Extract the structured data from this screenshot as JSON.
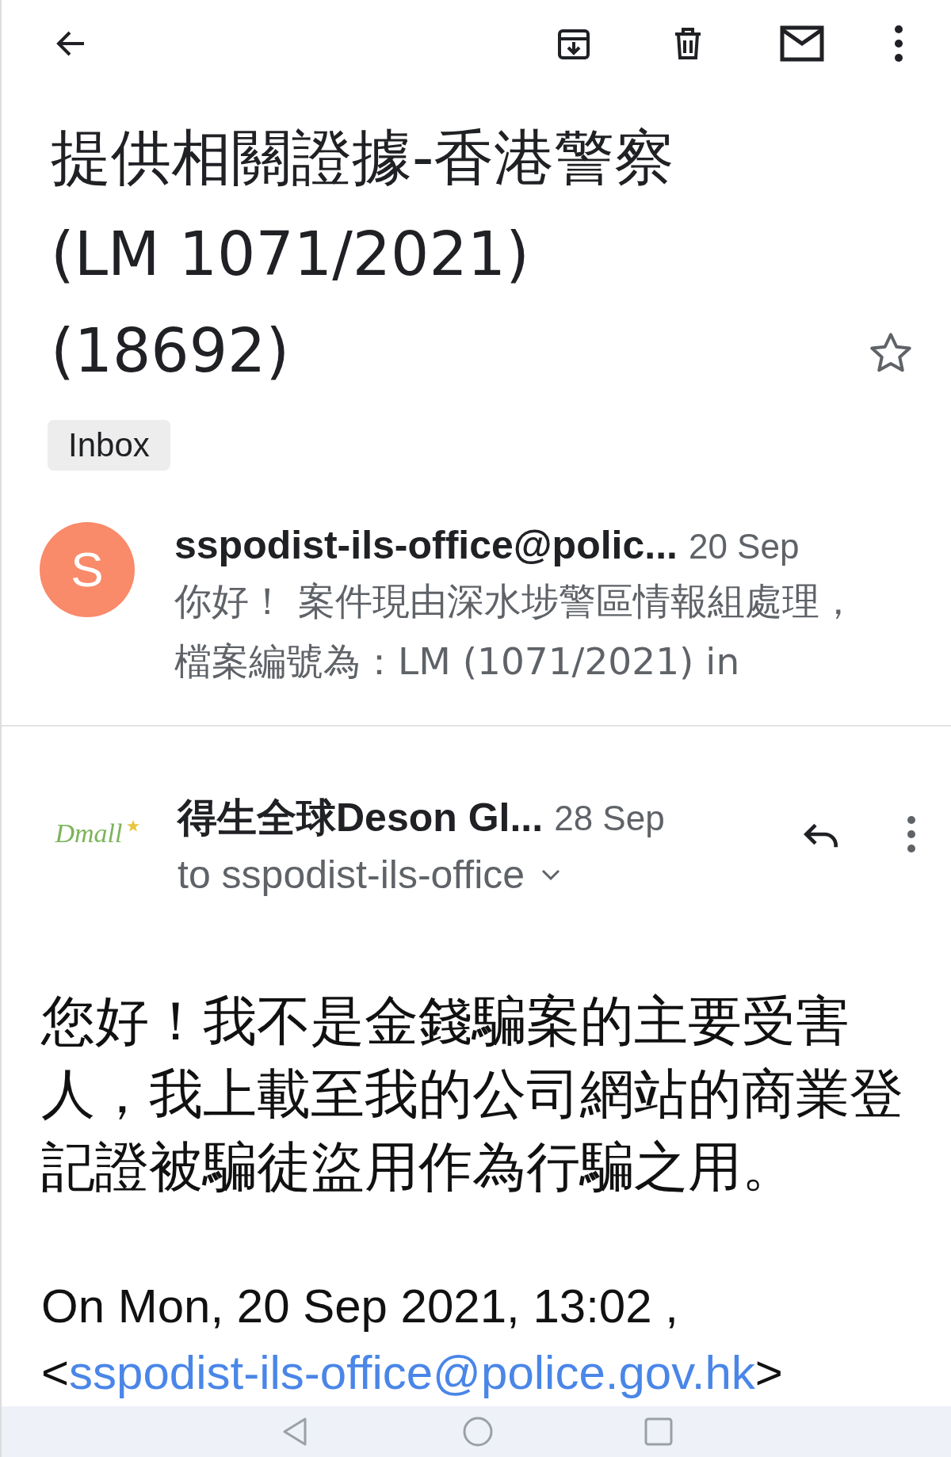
{
  "subject": "提供相關證據-香港警察 (LM 1071/2021) (18692)",
  "starred": false,
  "labels": [
    "Inbox"
  ],
  "messages": [
    {
      "kind": "collapsed",
      "avatar_letter": "S",
      "sender": "sspodist-ils-office@polic...",
      "date": "20 Sep",
      "preview": "你好！  案件現由深水埗警區情報組處理，檔案編號為：LM (1071/2021) in"
    },
    {
      "kind": "expanded",
      "logo_text": "Dmall",
      "sender": "得生全球Deson Gl...",
      "date": "28 Sep",
      "recipient": "to sspodist-ils-office",
      "body": "您好！我不是金錢騙案的主要受害人，我上載至我的公司網站的商業登記證被騙徒盜用作為行騙之用。",
      "quote_header": "On Mon, 20 Sep 2021, 13:02 ,",
      "quote_open": "<",
      "quote_link": "sspodist-ils-office@police.gov.hk",
      "quote_close": ">"
    }
  ]
}
